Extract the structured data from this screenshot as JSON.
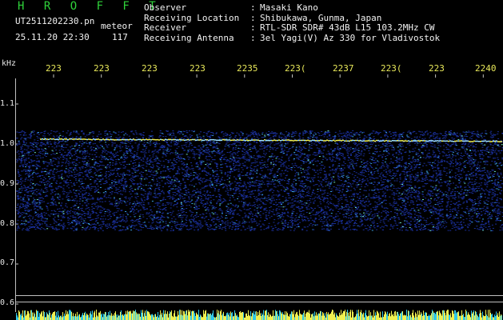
{
  "header": {
    "title": "H R O F F T",
    "filename": "UT2511202230.pn",
    "event_type": "meteor",
    "datetime": "25.11.20 22:30",
    "count": "117"
  },
  "metadata": [
    {
      "label": "Observer",
      "value": "Masaki Kano"
    },
    {
      "label": "Receiving Location",
      "value": "Shibukawa, Gunma, Japan"
    },
    {
      "label": "Receiver",
      "value": "RTL-SDR SDR# 43dB L15 103.2MHz CW"
    },
    {
      "label": "Receiving Antenna",
      "value": "3el Yagi(V) Az 330 for Vladivostok"
    }
  ],
  "separator": ":",
  "y_unit": "kHz",
  "x_ticks": [
    "223",
    "223",
    "223",
    "223",
    "2235",
    "223(",
    "2237",
    "223(",
    "223",
    "2240"
  ],
  "y_ticks": [
    "1.1",
    "1.0",
    "0.9",
    "0.8",
    "0.7",
    "0.6"
  ],
  "colors": {
    "background": "#000000",
    "title": "#2fd23a",
    "tick_label": "#e8e85a",
    "signal_strong": "#f0f050",
    "signal_mid": "#3aa0e0",
    "signal_low": "#1a2f9a"
  }
}
